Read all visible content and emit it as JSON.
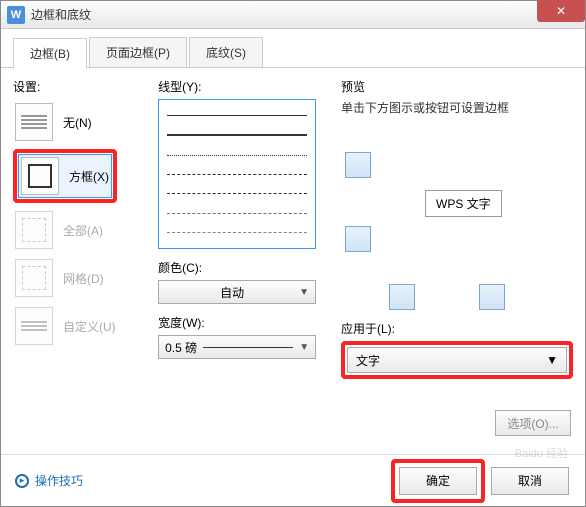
{
  "window": {
    "title": "边框和底纹"
  },
  "tabs": {
    "border": "边框(B)",
    "page_border": "页面边框(P)",
    "shading": "底纹(S)"
  },
  "settings": {
    "label": "设置:",
    "none": "无(N)",
    "box": "方框(X)",
    "all": "全部(A)",
    "grid": "网格(D)",
    "custom": "自定义(U)"
  },
  "line": {
    "type_label": "线型(Y):",
    "color_label": "颜色(C):",
    "color_value": "自动",
    "width_label": "宽度(W):",
    "width_value": "0.5  磅"
  },
  "preview": {
    "label": "预览",
    "hint": "单击下方图示或按钮可设置边框",
    "sample_text": "WPS 文字",
    "apply_label": "应用于(L):",
    "apply_value": "文字",
    "options": "选项(O)..."
  },
  "footer": {
    "tips": "操作技巧",
    "ok": "确定",
    "cancel": "取消"
  },
  "watermark": "Baidu 经验"
}
